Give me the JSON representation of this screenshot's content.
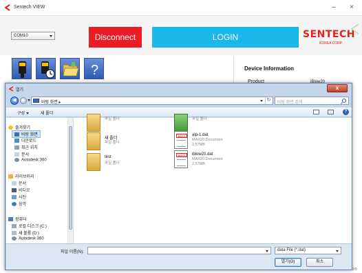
{
  "app": {
    "title": "Sentech VIEW",
    "minimize": "–",
    "close": "×",
    "brand": {
      "name": "SENTECH",
      "sub": "KOREA CORP."
    }
  },
  "toolbar": {
    "port": "COM10",
    "disconnect_label": "Disconnect",
    "login_label": "LOGIN"
  },
  "device": {
    "title": "Device Information",
    "product_label": "Product",
    "product_value": "iBlow20"
  },
  "background_time": "13:23:5",
  "dialog": {
    "title": "열기",
    "close": "x",
    "location": "바탕 화면 ▸",
    "search_placeholder": "바탕 화면 검색",
    "refresh": "↻",
    "organize": "구성",
    "new_folder": "새 폴더",
    "help": "?",
    "nav": {
      "favorites": "즐겨찾기",
      "desktop": "바탕 화면",
      "downloads": "다운로드",
      "recent": "최근 위치",
      "documents_fav": "문서",
      "autodesk_fav": "Autodesk 360",
      "libraries": "라이브러리",
      "lib_documents": "문서",
      "lib_videos": "비디오",
      "lib_pictures": "사진",
      "lib_music": "음악",
      "computer": "컴퓨터",
      "drive_c": "로컬 디스크 (C:)",
      "drive_d": "새 볼륨 (D:)",
      "autodesk_comp": "Autodesk 360"
    },
    "files": [
      {
        "name": "",
        "type": "파일 폴더",
        "size": ""
      },
      {
        "name": "",
        "type": "파일 폴더",
        "size": ""
      },
      {
        "name": "새 폴더",
        "type": "파일 폴더",
        "size": ""
      },
      {
        "name": "alp-1.dat",
        "type": "MAX20.Document",
        "size": "2.57MB"
      },
      {
        "name": "test",
        "type": "파일 폴더",
        "size": ""
      },
      {
        "name": "iblow20.dat",
        "type": "MAX20.Document",
        "size": "2.57MB"
      }
    ],
    "doc_tag": "DOC1",
    "filename_label": "파일 이름(N):",
    "filename_value": "",
    "filter": "data File (*.dat)",
    "open_label": "열기(O)",
    "cancel_label": "취소"
  }
}
